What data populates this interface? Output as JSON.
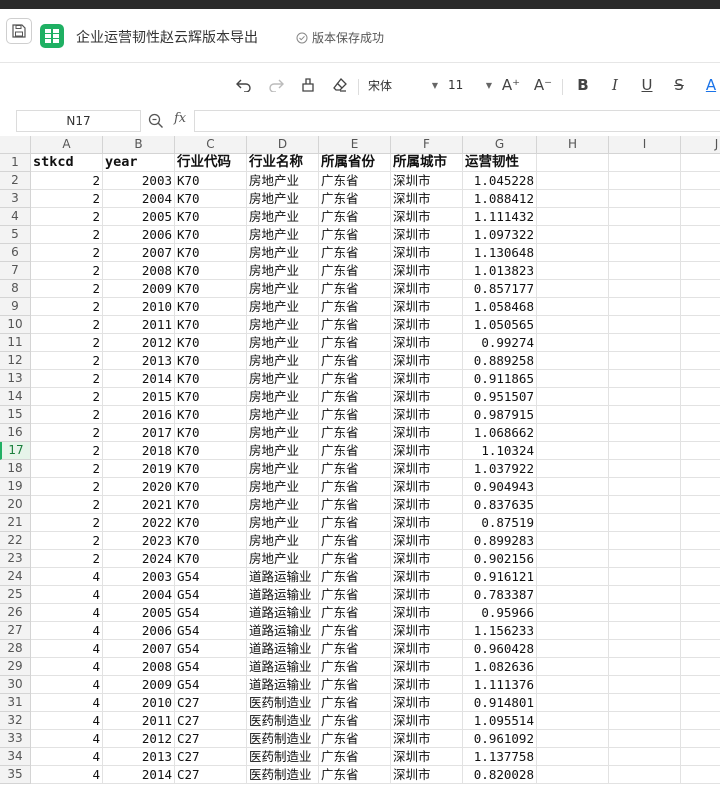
{
  "titlebar": {
    "doc_title": "企业运营韧性赵云辉版本导出",
    "save_status": "版本保存成功"
  },
  "toolbar": {
    "font_name": "宋体",
    "font_size": "11",
    "bold_label": "B",
    "italic_label": "I",
    "underline_label": "U",
    "strike_label": "S",
    "font_color_label": "A",
    "increase_font_label": "A⁺",
    "decrease_font_label": "A⁻"
  },
  "formula_bar": {
    "cell_ref": "N17",
    "fx_label": "fx",
    "formula": ""
  },
  "columns": [
    "A",
    "B",
    "C",
    "D",
    "E",
    "F",
    "G",
    "H",
    "I",
    "J"
  ],
  "header_row": [
    "stkcd",
    "year",
    "行业代码",
    "行业名称",
    "所属省份",
    "所属城市",
    "运营韧性"
  ],
  "active_row": 17,
  "rows": [
    [
      "2",
      "2003",
      "K70",
      "房地产业",
      "广东省",
      "深圳市",
      "1.045228"
    ],
    [
      "2",
      "2004",
      "K70",
      "房地产业",
      "广东省",
      "深圳市",
      "1.088412"
    ],
    [
      "2",
      "2005",
      "K70",
      "房地产业",
      "广东省",
      "深圳市",
      "1.111432"
    ],
    [
      "2",
      "2006",
      "K70",
      "房地产业",
      "广东省",
      "深圳市",
      "1.097322"
    ],
    [
      "2",
      "2007",
      "K70",
      "房地产业",
      "广东省",
      "深圳市",
      "1.130648"
    ],
    [
      "2",
      "2008",
      "K70",
      "房地产业",
      "广东省",
      "深圳市",
      "1.013823"
    ],
    [
      "2",
      "2009",
      "K70",
      "房地产业",
      "广东省",
      "深圳市",
      "0.857177"
    ],
    [
      "2",
      "2010",
      "K70",
      "房地产业",
      "广东省",
      "深圳市",
      "1.058468"
    ],
    [
      "2",
      "2011",
      "K70",
      "房地产业",
      "广东省",
      "深圳市",
      "1.050565"
    ],
    [
      "2",
      "2012",
      "K70",
      "房地产业",
      "广东省",
      "深圳市",
      "0.99274"
    ],
    [
      "2",
      "2013",
      "K70",
      "房地产业",
      "广东省",
      "深圳市",
      "0.889258"
    ],
    [
      "2",
      "2014",
      "K70",
      "房地产业",
      "广东省",
      "深圳市",
      "0.911865"
    ],
    [
      "2",
      "2015",
      "K70",
      "房地产业",
      "广东省",
      "深圳市",
      "0.951507"
    ],
    [
      "2",
      "2016",
      "K70",
      "房地产业",
      "广东省",
      "深圳市",
      "0.987915"
    ],
    [
      "2",
      "2017",
      "K70",
      "房地产业",
      "广东省",
      "深圳市",
      "1.068662"
    ],
    [
      "2",
      "2018",
      "K70",
      "房地产业",
      "广东省",
      "深圳市",
      "1.10324"
    ],
    [
      "2",
      "2019",
      "K70",
      "房地产业",
      "广东省",
      "深圳市",
      "1.037922"
    ],
    [
      "2",
      "2020",
      "K70",
      "房地产业",
      "广东省",
      "深圳市",
      "0.904943"
    ],
    [
      "2",
      "2021",
      "K70",
      "房地产业",
      "广东省",
      "深圳市",
      "0.837635"
    ],
    [
      "2",
      "2022",
      "K70",
      "房地产业",
      "广东省",
      "深圳市",
      "0.87519"
    ],
    [
      "2",
      "2023",
      "K70",
      "房地产业",
      "广东省",
      "深圳市",
      "0.899283"
    ],
    [
      "2",
      "2024",
      "K70",
      "房地产业",
      "广东省",
      "深圳市",
      "0.902156"
    ],
    [
      "4",
      "2003",
      "G54",
      "道路运输业",
      "广东省",
      "深圳市",
      "0.916121"
    ],
    [
      "4",
      "2004",
      "G54",
      "道路运输业",
      "广东省",
      "深圳市",
      "0.783387"
    ],
    [
      "4",
      "2005",
      "G54",
      "道路运输业",
      "广东省",
      "深圳市",
      "0.95966"
    ],
    [
      "4",
      "2006",
      "G54",
      "道路运输业",
      "广东省",
      "深圳市",
      "1.156233"
    ],
    [
      "4",
      "2007",
      "G54",
      "道路运输业",
      "广东省",
      "深圳市",
      "0.960428"
    ],
    [
      "4",
      "2008",
      "G54",
      "道路运输业",
      "广东省",
      "深圳市",
      "1.082636"
    ],
    [
      "4",
      "2009",
      "G54",
      "道路运输业",
      "广东省",
      "深圳市",
      "1.111376"
    ],
    [
      "4",
      "2010",
      "C27",
      "医药制造业",
      "广东省",
      "深圳市",
      "0.914801"
    ],
    [
      "4",
      "2011",
      "C27",
      "医药制造业",
      "广东省",
      "深圳市",
      "1.095514"
    ],
    [
      "4",
      "2012",
      "C27",
      "医药制造业",
      "广东省",
      "深圳市",
      "0.961092"
    ],
    [
      "4",
      "2013",
      "C27",
      "医药制造业",
      "广东省",
      "深圳市",
      "1.137758"
    ],
    [
      "4",
      "2014",
      "C27",
      "医药制造业",
      "广东省",
      "深圳市",
      "0.820028"
    ]
  ]
}
